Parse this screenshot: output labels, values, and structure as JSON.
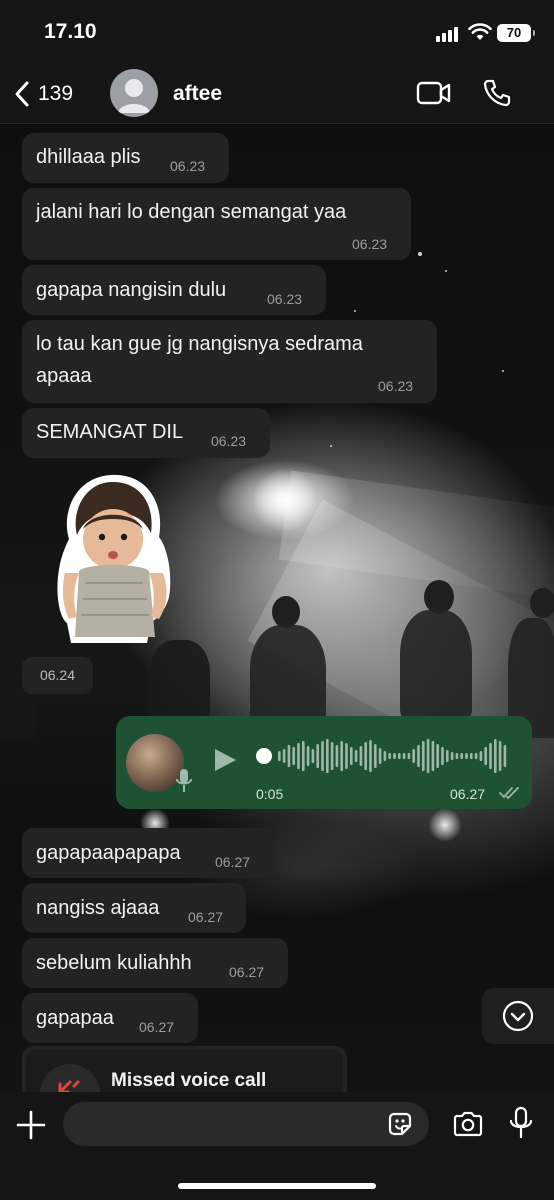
{
  "status_bar": {
    "time": "17.10",
    "battery": "70"
  },
  "header": {
    "back_count": "139",
    "contact_name": "aftee"
  },
  "messages": [
    {
      "text": "dhillaaa plis",
      "time": "06.23"
    },
    {
      "text": "jalani hari lo dengan semangat yaa",
      "time": "06.23"
    },
    {
      "text": "gapapa nangisin dulu",
      "time": "06.23"
    },
    {
      "text_line1": "lo tau kan gue jg nangisnya sedrama",
      "text_line2": "apaaa",
      "time": "06.23"
    },
    {
      "text": "SEMANGAT DIL",
      "time": "06.23"
    },
    {
      "sticker": "toddler-sticker",
      "time": "06.24"
    },
    {
      "voice_duration": "0:05",
      "time": "06.27"
    },
    {
      "text": "gapapaapapapa",
      "time": "06.27"
    },
    {
      "text": "nangiss ajaaa",
      "time": "06.27"
    },
    {
      "text": "sebelum kuliahhh",
      "time": "06.27"
    },
    {
      "text": "gapapaa",
      "time": "06.27"
    }
  ],
  "missed_call": {
    "label": "Missed voice call"
  },
  "input": {
    "placeholder": ""
  },
  "colors": {
    "outgoing_bubble": "#1e5233",
    "incoming_bubble": "#232323",
    "missed_call_icon": "#e0463c"
  }
}
